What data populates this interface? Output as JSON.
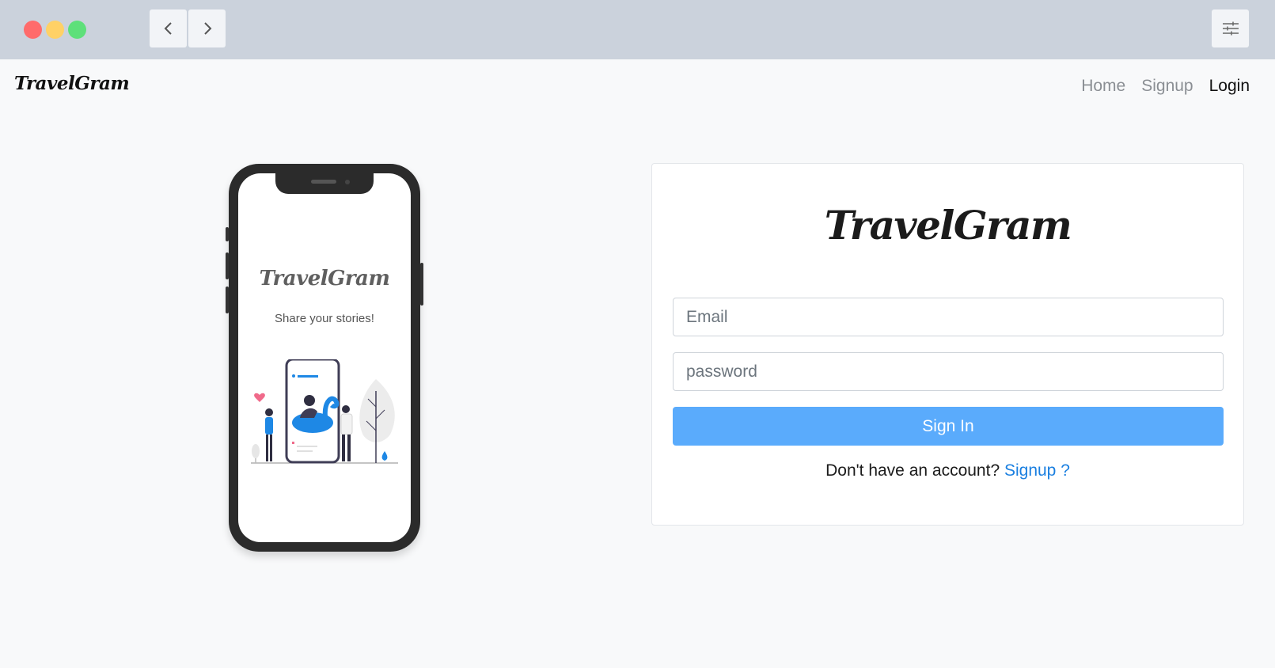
{
  "browser": {
    "colors": {
      "close": "#ff6b6b",
      "minimize": "#ffd166",
      "maximize": "#5ee07a"
    },
    "icons": {
      "back": "chevron-left-icon",
      "forward": "chevron-right-icon",
      "settings": "sliders-icon"
    }
  },
  "navbar": {
    "brand": "TravelGram",
    "links": [
      {
        "label": "Home",
        "active": false
      },
      {
        "label": "Signup",
        "active": false
      },
      {
        "label": "Login",
        "active": true
      }
    ]
  },
  "phone": {
    "brand": "TravelGram",
    "tagline": "Share your stories!"
  },
  "login": {
    "brand": "TravelGram",
    "email_placeholder": "Email",
    "password_placeholder": "password",
    "submit_label": "Sign In",
    "signup_prompt": "Don't have an account?",
    "signup_link": "Signup ?",
    "accent": "#5aabfc",
    "link_color": "#1a7fe0"
  }
}
